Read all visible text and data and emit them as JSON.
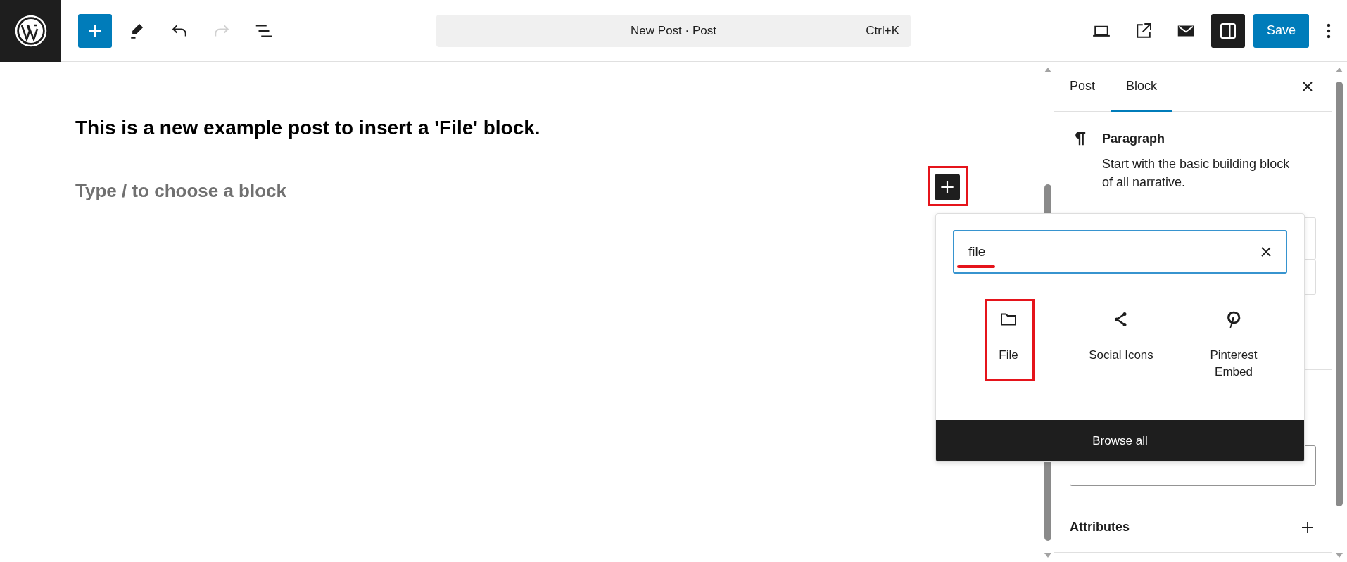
{
  "topbar": {
    "tools": [
      {
        "kind": "inserter",
        "disabled": false
      },
      {
        "kind": "pen",
        "disabled": false
      },
      {
        "kind": "undo",
        "disabled": false
      },
      {
        "kind": "redo",
        "disabled": true
      },
      {
        "kind": "outline",
        "disabled": false
      }
    ],
    "command": {
      "title": "New Post · Post",
      "shortcut": "Ctrl+K"
    },
    "actions": [
      {
        "kind": "preview",
        "pressed": false
      },
      {
        "kind": "view",
        "pressed": false
      },
      {
        "kind": "mail",
        "pressed": false
      },
      {
        "kind": "settings",
        "pressed": true
      }
    ],
    "save": "Save"
  },
  "editor": {
    "blocks": [
      {
        "kind": "paragraph",
        "text": "This is a new example post to insert a 'File' block."
      }
    ],
    "placeholder": "Type / to choose a block",
    "inserter": {
      "highlighted": true
    }
  },
  "inserter_popover": {
    "search": {
      "value": "file",
      "underlined": true
    },
    "results": [
      {
        "kind": "folder",
        "label": "File",
        "highlighted": true
      },
      {
        "kind": "share",
        "label": "Social Icons",
        "highlighted": false
      },
      {
        "kind": "pinterest",
        "label": "Pinterest Embed",
        "highlighted": false
      }
    ],
    "browse_all": "Browse all"
  },
  "sidebar": {
    "tabs": [
      {
        "label": "Post",
        "selected": false
      },
      {
        "label": "Block",
        "selected": true
      }
    ],
    "block": {
      "title": "Paragraph",
      "description": "Start with the basic building block of all narrative."
    },
    "panels": [
      {
        "title": "Attributes",
        "expanded": false
      }
    ]
  }
}
